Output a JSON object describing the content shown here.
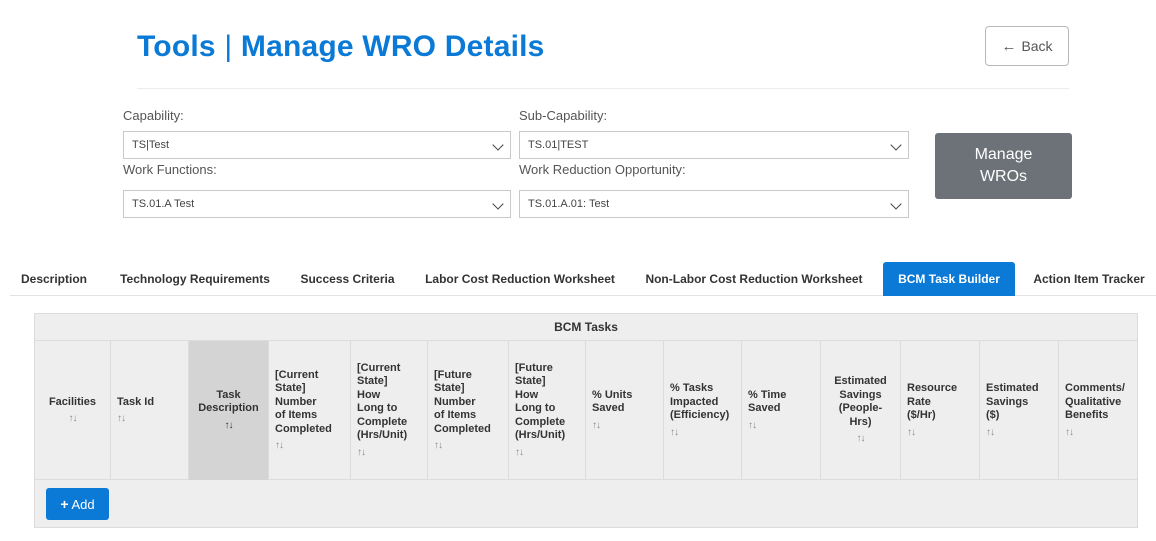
{
  "header": {
    "title_left": "Tools",
    "title_sep": "|",
    "title_right": "Manage WRO Details",
    "back_label": "Back"
  },
  "filters": {
    "capability_label": "Capability:",
    "capability_value": "TS|Test",
    "sub_capability_label": "Sub-Capability:",
    "sub_capability_value": "TS.01|TEST",
    "work_functions_label": "Work Functions:",
    "work_functions_value": "TS.01.A Test",
    "wro_label": "Work Reduction Opportunity:",
    "wro_value": "TS.01.A.01: Test",
    "manage_line1": "Manage",
    "manage_line2": "WROs"
  },
  "tabs": [
    {
      "label": "Description"
    },
    {
      "label": "Technology Requirements"
    },
    {
      "label": "Success Criteria"
    },
    {
      "label": "Labor Cost Reduction Worksheet"
    },
    {
      "label": "Non-Labor Cost Reduction Worksheet"
    },
    {
      "label": "BCM Task Builder",
      "active": true
    },
    {
      "label": "Action Item Tracker"
    }
  ],
  "table": {
    "caption": "BCM Tasks",
    "columns": [
      {
        "label": "Facilities"
      },
      {
        "label": "Task Id"
      },
      {
        "label": "Task\nDescription"
      },
      {
        "label": "[Current\nState]\nNumber\nof Items\nCompleted"
      },
      {
        "label": "[Current\nState]\nHow\nLong to\nComplete\n(Hrs/Unit)"
      },
      {
        "label": "[Future\nState]\nNumber\nof Items\nCompleted"
      },
      {
        "label": "[Future\nState]\nHow\nLong to\nComplete\n(Hrs/Unit)"
      },
      {
        "label": "% Units\nSaved"
      },
      {
        "label": "% Tasks\nImpacted\n(Efficiency)"
      },
      {
        "label": "% Time\nSaved"
      },
      {
        "label": "Estimated\nSavings\n(People-\nHrs)"
      },
      {
        "label": "Resource\nRate\n($/Hr)"
      },
      {
        "label": "Estimated\nSavings\n($)"
      },
      {
        "label": "Comments/\nQualitative\nBenefits"
      }
    ],
    "sort_glyph": "↑↓",
    "add_label": "Add"
  },
  "colors": {
    "accent": "#0a7ad6",
    "manage_button": "#6c7277",
    "panel_bg": "#eeeeee",
    "sorted_col_bg": "#d4d4d4"
  },
  "icons": {
    "back": "arrow-left-icon",
    "dropdown": "chevron-down-icon",
    "sort": "sort-icon",
    "add": "plus-icon"
  }
}
